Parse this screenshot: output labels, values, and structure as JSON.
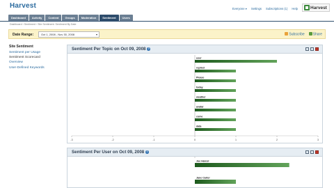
{
  "app": {
    "title": "Harvest",
    "logo_text": "Harvest"
  },
  "top_links": [
    "Everyone ▾",
    "Settings",
    "Subscriptions (1)",
    "Help"
  ],
  "tabs": [
    {
      "label": "Dashboard",
      "active": false
    },
    {
      "label": "Activity",
      "active": false
    },
    {
      "label": "Content",
      "active": false
    },
    {
      "label": "Groups",
      "active": false
    },
    {
      "label": "Moderation",
      "active": false
    },
    {
      "label": "Sentiment",
      "active": true
    },
    {
      "label": "Users",
      "active": false
    }
  ],
  "breadcrumb": "Dashboard › Sentiment › Site Sentiment: Sentiment By Date",
  "date_range": {
    "label": "Date Range:",
    "value": "Oct 1, 2008 - Nov 30, 2008",
    "subscribe": "Subscribe",
    "share": "Share"
  },
  "sidebar": {
    "heading": "Site Sentiment",
    "items": [
      {
        "label": "Sentiment per Usage",
        "current": false
      },
      {
        "label": "Sentiment Scorecard",
        "current": true
      },
      {
        "label": "Overview",
        "current": false
      },
      {
        "label": "User-Defined Keywords",
        "current": false
      }
    ]
  },
  "colors": {
    "accent": "#2e4d6c",
    "bar_dark": "#1d5a1d",
    "bar_light": "#62a35a",
    "panel_head": "#e6edf3"
  },
  "panels": [
    {
      "title": "Sentiment Per Topic on Oct 09, 2008",
      "chart_data": {
        "type": "bar",
        "orientation": "horizontal",
        "categories": [
          "user",
          "replied",
          "Please",
          "today",
          "weather",
          "avatar",
          "come",
          "data"
        ],
        "values": [
          2.0,
          1.0,
          1.0,
          1.0,
          1.0,
          1.0,
          1.0,
          1.0
        ],
        "xlim": [
          -3,
          3
        ],
        "x_ticks": [
          "-3",
          "-2",
          "-1",
          "0",
          "1",
          "2",
          "3"
        ],
        "title": "Sentiment Per Topic on Oct 09, 2008"
      }
    },
    {
      "title": "Sentiment Per User on Oct 09, 2008",
      "chart_data": {
        "type": "bar",
        "orientation": "horizontal",
        "categories": [
          "Joe Harcol",
          "Jane Carter"
        ],
        "values": [
          2.3,
          1.0
        ],
        "xlim": [
          -3,
          3
        ],
        "title": "Sentiment Per User on Oct 09, 2008"
      }
    }
  ]
}
